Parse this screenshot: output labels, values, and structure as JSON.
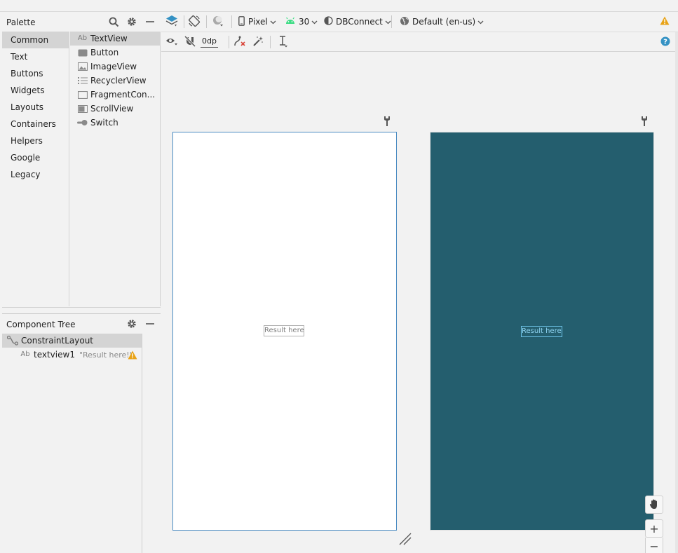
{
  "palette": {
    "title": "Palette",
    "categories": [
      "Common",
      "Text",
      "Buttons",
      "Widgets",
      "Layouts",
      "Containers",
      "Helpers",
      "Google",
      "Legacy"
    ],
    "items": [
      {
        "label": "TextView",
        "icon": "textview-icon"
      },
      {
        "label": "Button",
        "icon": "button-icon"
      },
      {
        "label": "ImageView",
        "icon": "imageview-icon"
      },
      {
        "label": "RecyclerView",
        "icon": "recyclerview-icon"
      },
      {
        "label": "FragmentCon...",
        "icon": "fragment-icon"
      },
      {
        "label": "ScrollView",
        "icon": "scrollview-icon"
      },
      {
        "label": "Switch",
        "icon": "switch-icon"
      }
    ],
    "icon_text_ab": "Ab"
  },
  "component_tree": {
    "title": "Component Tree",
    "root": "ConstraintLayout",
    "child_label": "textview1",
    "child_value": "\"Result here!\""
  },
  "toolbar": {
    "device": "Pixel",
    "api": "30",
    "theme": "DBConnect",
    "locale": "Default (en-us)",
    "margin": "0dp"
  },
  "canvas": {
    "design_text": "Result here!",
    "blueprint_text": "Result here!",
    "zoom_in": "+",
    "zoom_out": "−"
  },
  "colors": {
    "blueprint_bg": "#245e6e",
    "selection_blue": "#4a8bc2",
    "warning": "#e8a317",
    "android_green": "#3ddc84"
  }
}
